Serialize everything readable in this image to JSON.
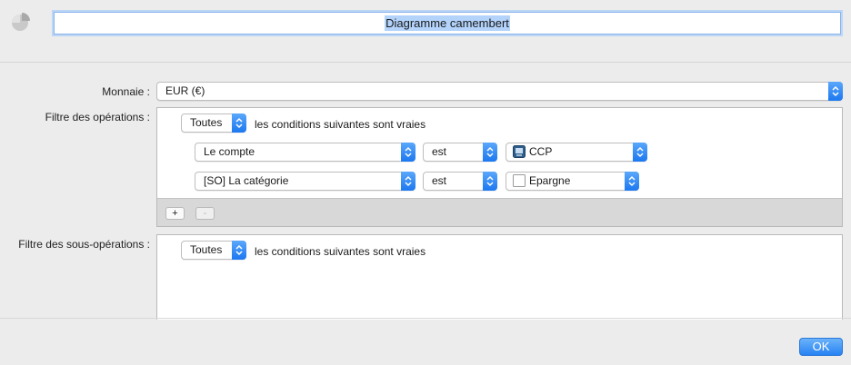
{
  "header": {
    "title_value": "Diagramme camembert",
    "icon": "pie-chart-icon"
  },
  "form": {
    "currency_label": "Monnaie :",
    "currency_value": "EUR (€)",
    "ops_filter_label": "Filtre des opérations :",
    "subops_filter_label": "Filtre des sous-opérations :"
  },
  "ops_filter": {
    "match_value": "Toutes",
    "match_text": "les conditions suivantes sont vraies",
    "rules": [
      {
        "field": "Le compte",
        "operator": "est",
        "value": "CCP",
        "value_icon": "account-icon"
      },
      {
        "field": "[SO] La catégorie",
        "operator": "est",
        "value": "Epargne",
        "value_icon": "blank-checkbox-icon"
      }
    ],
    "add_label": "+",
    "remove_label": "-"
  },
  "subops_filter": {
    "match_value": "Toutes",
    "match_text": "les conditions suivantes sont vraies"
  },
  "footer": {
    "ok_label": "OK"
  },
  "colors": {
    "accent": "#1c78f0",
    "background": "#ececec"
  }
}
